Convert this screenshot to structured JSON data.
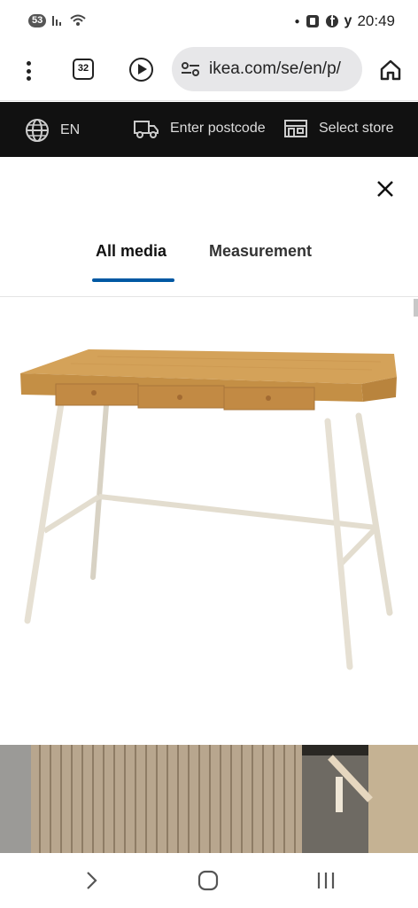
{
  "status_bar": {
    "notification_count": "53",
    "time": "20:49",
    "icons": [
      "signal-icon",
      "wifi-icon",
      "dot-icon",
      "app-notification-icon",
      "facebook-icon",
      "y-app-icon"
    ]
  },
  "browser": {
    "tab_count": "32",
    "url": "ikea.com/se/en/p/",
    "icons": [
      "menu-dots-icon",
      "tabs-icon",
      "play-icon",
      "site-settings-icon",
      "home-icon"
    ]
  },
  "ikea_header": {
    "language": "EN",
    "postcode": "Enter postcode",
    "store": "Select store",
    "icons": [
      "globe-icon",
      "truck-icon",
      "store-icon"
    ]
  },
  "media_sheet": {
    "tabs": [
      {
        "label": "All media",
        "active": true
      },
      {
        "label": "Measurement",
        "active": false
      }
    ],
    "icons": [
      "close-icon"
    ],
    "product_image": "bamboo desk with three drawers and white legs",
    "thumbnails": [
      "wood slat wall detail",
      "desk leg detail"
    ]
  },
  "nav_bar": {
    "icons": [
      "back-icon",
      "home-circle-icon",
      "recents-icon"
    ]
  },
  "colors": {
    "accent": "#0058a3",
    "header_bg": "#111111",
    "url_bar_bg": "#e7e7e9",
    "desk_wood": "#c9964e",
    "desk_legs": "#e3ddcf"
  }
}
